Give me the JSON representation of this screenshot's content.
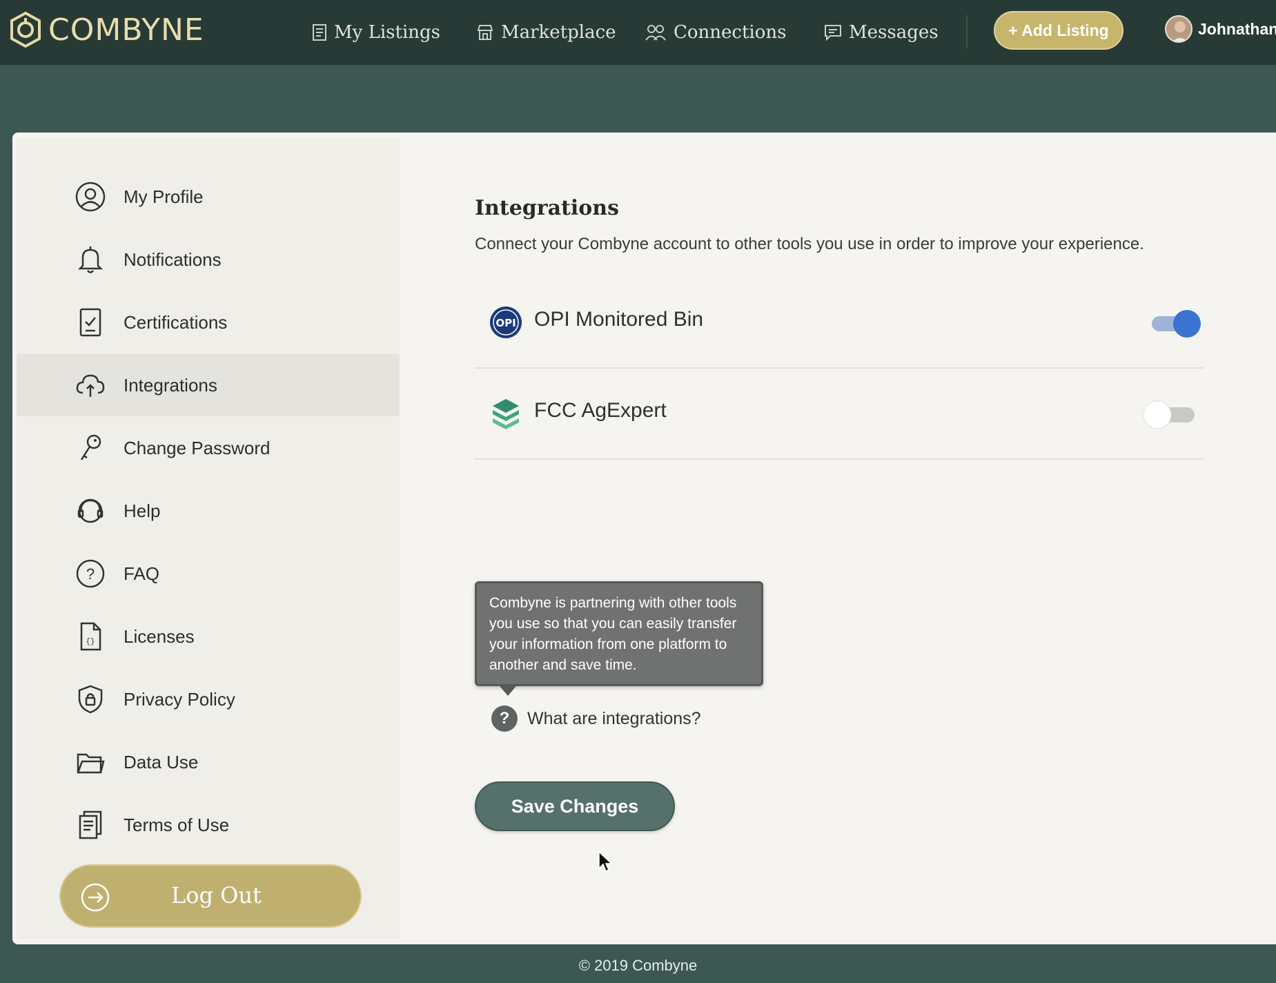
{
  "brand": {
    "name": "COMBYNE",
    "accent": "#c8b56c",
    "topbar_color": "#273a35"
  },
  "nav": {
    "items": [
      {
        "label": "My Listings",
        "icon": "listings-icon"
      },
      {
        "label": "Marketplace",
        "icon": "storefront-icon"
      },
      {
        "label": "Connections",
        "icon": "people-icon"
      },
      {
        "label": "Messages",
        "icon": "chat-icon"
      }
    ],
    "add_listing": "+ Add Listing",
    "user": "Johnathan"
  },
  "sidebar": {
    "items": [
      {
        "label": "My Profile",
        "icon": "user-circle-icon"
      },
      {
        "label": "Notifications",
        "icon": "bell-icon"
      },
      {
        "label": "Certifications",
        "icon": "certificate-icon"
      },
      {
        "label": "Integrations",
        "icon": "cloud-sync-icon",
        "active": true
      },
      {
        "label": "Change Password",
        "icon": "key-icon"
      },
      {
        "label": "Help",
        "icon": "headset-icon"
      },
      {
        "label": "FAQ",
        "icon": "question-circle-icon"
      },
      {
        "label": "Licenses",
        "icon": "code-file-icon"
      },
      {
        "label": "Privacy Policy",
        "icon": "shield-lock-icon"
      },
      {
        "label": "Data Use",
        "icon": "folder-icon"
      },
      {
        "label": "Terms of Use",
        "icon": "documents-icon"
      }
    ],
    "logout": "Log Out"
  },
  "main": {
    "title": "Integrations",
    "subtitle": "Connect your Combyne account to other tools you use in order to improve your experience.",
    "integrations": [
      {
        "name": "OPI Monitored Bin",
        "logo": "OPI",
        "enabled": true
      },
      {
        "name": "FCC AgExpert",
        "logo": "agexpert-logo",
        "enabled": false
      }
    ],
    "tooltip": "Combyne is partnering with other tools you use so that you can easily transfer your information from one platform to another and save time.",
    "help_link": "What are integrations?",
    "help_icon": "?",
    "save": "Save Changes"
  },
  "footer": "© 2019 Combyne"
}
